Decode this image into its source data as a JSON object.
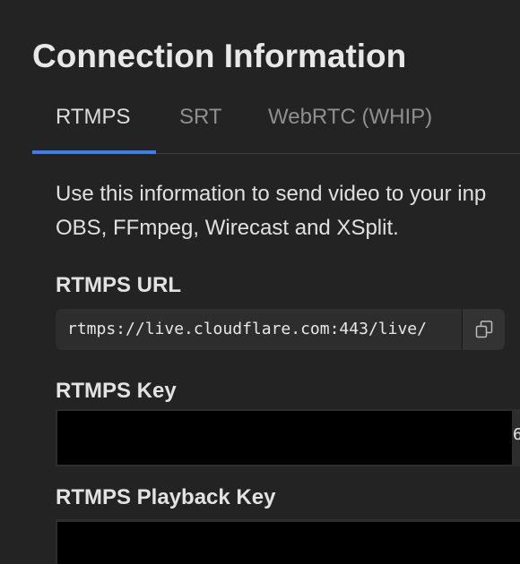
{
  "page": {
    "title": "Connection Information"
  },
  "tabs": [
    {
      "label": "RTMPS",
      "active": true
    },
    {
      "label": "SRT",
      "active": false
    },
    {
      "label": "WebRTC (WHIP)",
      "active": false
    }
  ],
  "description": {
    "line1": "Use this information to send video to your inp",
    "line2": "OBS, FFmpeg, Wirecast and XSplit."
  },
  "rtmps_url": {
    "label": "RTMPS URL",
    "value": "rtmps://live.cloudflare.com:443/live/",
    "copy_icon": "copy-icon"
  },
  "rtmps_key": {
    "label": "RTMPS Key",
    "visible_tail": "6"
  },
  "rtmps_playback_key": {
    "label": "RTMPS Playback Key"
  },
  "colors": {
    "background": "#232323",
    "accent": "#3e7ee8",
    "field": "#2d2d2d",
    "redaction": "#000000"
  }
}
